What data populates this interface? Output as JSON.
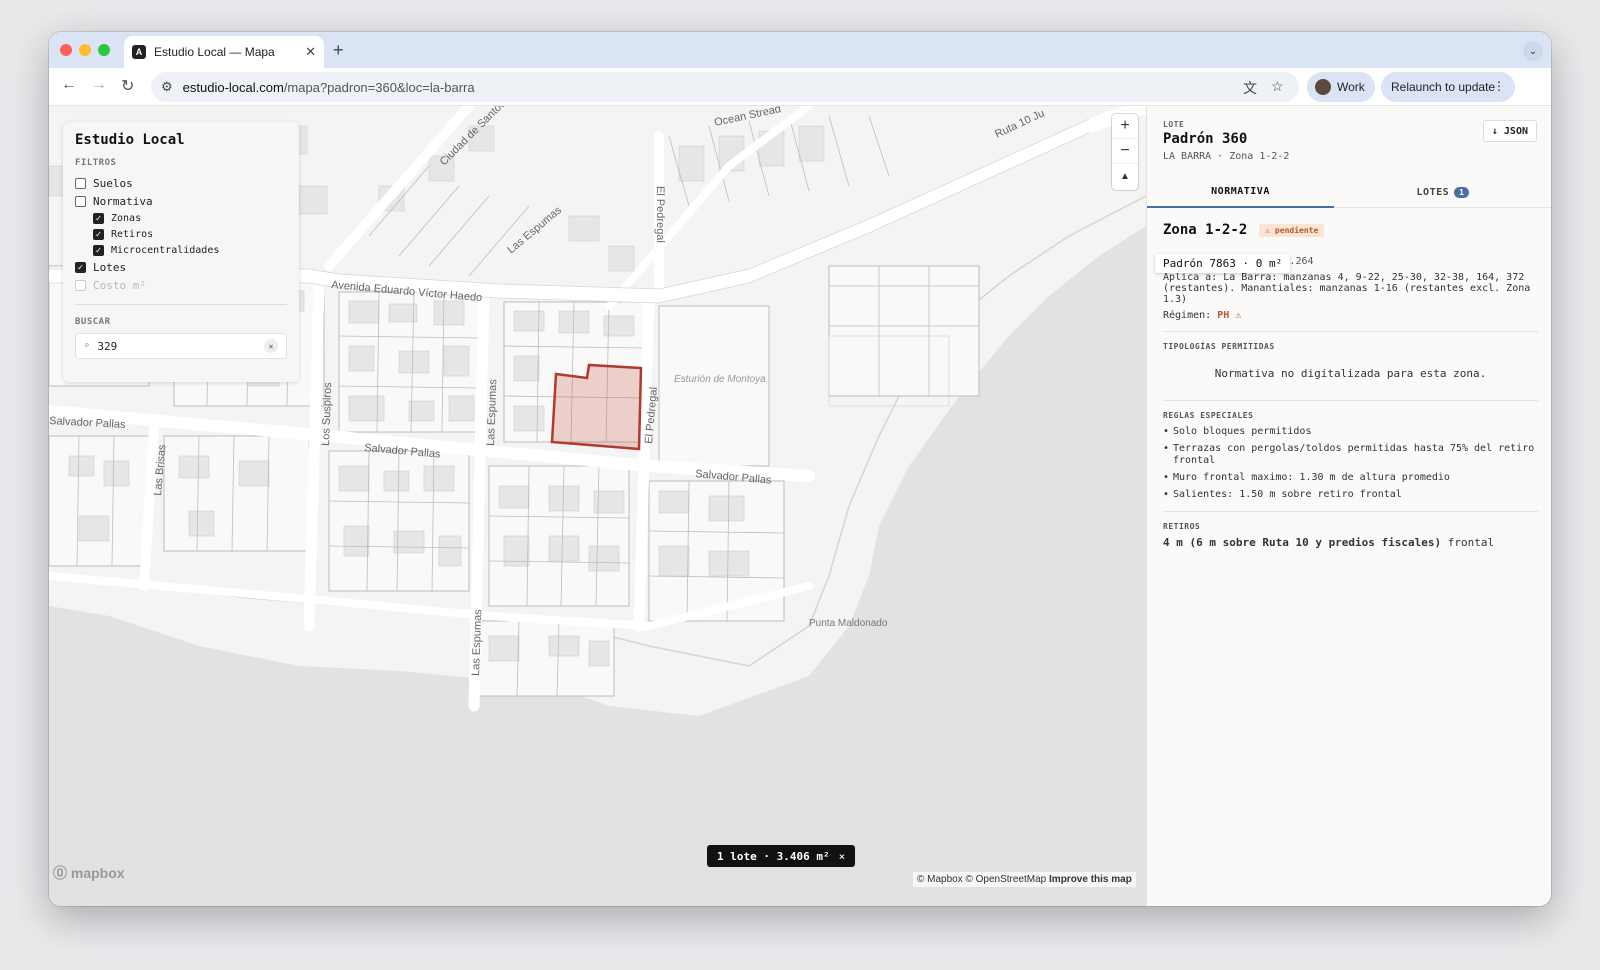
{
  "browser": {
    "tab_title": "Estudio Local — Mapa",
    "tab_favicon": "A",
    "url_host": "estudio-local.com",
    "url_path": "/mapa?padron=360&loc=la-barra",
    "profile_label": "Work",
    "relaunch_label": "Relaunch to update"
  },
  "filters": {
    "title": "Estudio Local",
    "section_filters": "FILTROS",
    "items": [
      {
        "label": "Suelos",
        "checked": false
      },
      {
        "label": "Normativa",
        "checked": false
      },
      {
        "label": "Zonas",
        "checked": true
      },
      {
        "label": "Retiros",
        "checked": true
      },
      {
        "label": "Microcentralidades",
        "checked": true
      },
      {
        "label": "Lotes",
        "checked": true
      },
      {
        "label": "Costo m²",
        "checked": false
      }
    ],
    "section_search": "BUSCAR",
    "search_value": "329",
    "search_icon": "⌕",
    "clear_icon": "×"
  },
  "map": {
    "street_labels": [
      "Avenida Eduardo Víctor Haedo",
      "Salvador Pallas",
      "Salvador Pallas",
      "Salvador Pallas",
      "Las Espumas",
      "Las Espumas",
      "Las Espumas",
      "El Pedregal",
      "El Pedregal",
      "Los Suspiros",
      "Las Brisas",
      "Ciudad de Santos",
      "Ocean Stread",
      "Ruta 10 Ju"
    ],
    "place_labels": [
      "Esturión de Montoya",
      "Punta Maldonado"
    ],
    "zoom_in": "+",
    "zoom_out": "−",
    "compass": "▲",
    "selection_text": "1 lote · 3.406 m²",
    "selection_close": "×",
    "logo": "mapbox",
    "attribution_prefix": "© Mapbox © OpenStreetMap",
    "attribution_link": "Improve this map",
    "selected_lot_color": "#c0392b"
  },
  "panel": {
    "kicker": "LOTE",
    "title": "Padrón 360",
    "subtitle": "LA BARRA · Zona 1-2-2",
    "json_button": "↓ JSON",
    "tab_normativa": "NORMATIVA",
    "tab_lotes": "LOTES",
    "lotes_count": "1",
    "zone_name": "Zona 1-2-2",
    "pending_badge": "⚠ pendiente",
    "tooltip": "Padrón 7863 · 0 m²",
    "decree": "Dto. 3718/1997 Art. D.264",
    "applies": "Aplica a: La Barra: manzanas 4, 9-22, 25-30, 32-38, 164, 372 (restantes). Manantiales: manzanas 1-16 (restantes excl. Zona 1.3)",
    "regimen_label": "Régimen:",
    "regimen_value": "PH ⚠",
    "tipologias_header": "TIPOLOGÍAS PERMITIDAS",
    "tipologias_empty": "Normativa no digitalizada para esta zona.",
    "reglas_header": "REGLAS ESPECIALES",
    "reglas": [
      "Solo bloques permitidos",
      "Terrazas con pergolas/toldos permitidas hasta 75% del retiro frontal",
      "Muro frontal maximo: 1.30 m de altura promedio",
      "Salientes: 1.50 m sobre retiro frontal"
    ],
    "retiros_header": "RETIROS",
    "retiros_value": "4 m (6 m sobre Ruta 10 y predios fiscales)",
    "retiros_suffix": "frontal"
  }
}
